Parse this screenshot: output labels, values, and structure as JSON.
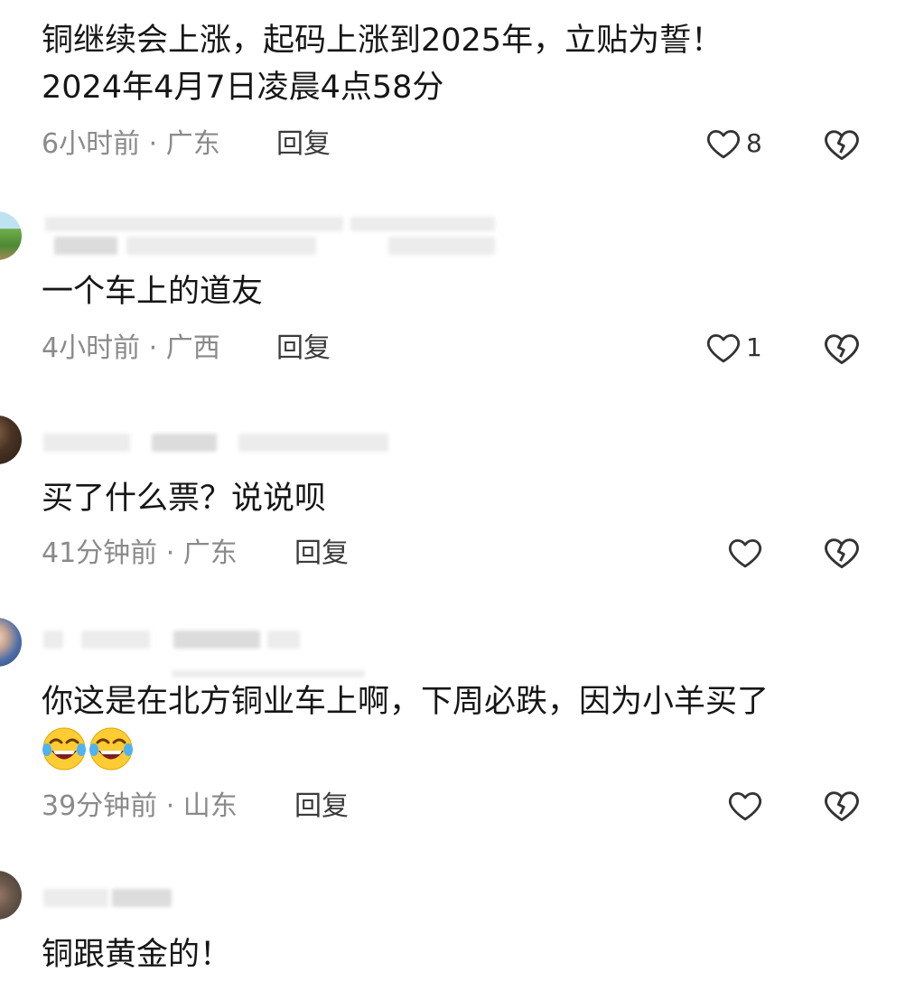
{
  "comments": [
    {
      "text_line1": "铜继续会上涨，起码上涨到2025年，立贴为誓！",
      "text_line2": "2024年4月7日凌晨4点58分",
      "meta": "6小时前 · 广东",
      "reply_label": "回复",
      "likes": "8"
    },
    {
      "text": "一个车上的道友",
      "meta": "4小时前 · 广西",
      "reply_label": "回复",
      "likes": "1"
    },
    {
      "text": "买了什么票？说说呗",
      "meta": "41分钟前 · 广东",
      "reply_label": "回复"
    },
    {
      "text": "你这是在北方铜业车上啊，下周必跌，因为小羊买了",
      "meta": "39分钟前 · 山东",
      "reply_label": "回复",
      "emoji_name": "rolling-on-floor-laughing"
    },
    {
      "text": "铜跟黄金的！"
    }
  ],
  "icons": {
    "like": "heart-outline-icon",
    "dislike": "broken-heart-icon"
  },
  "colors": {
    "text": "#161616",
    "meta": "#8a8a8a",
    "icon": "#333333"
  }
}
